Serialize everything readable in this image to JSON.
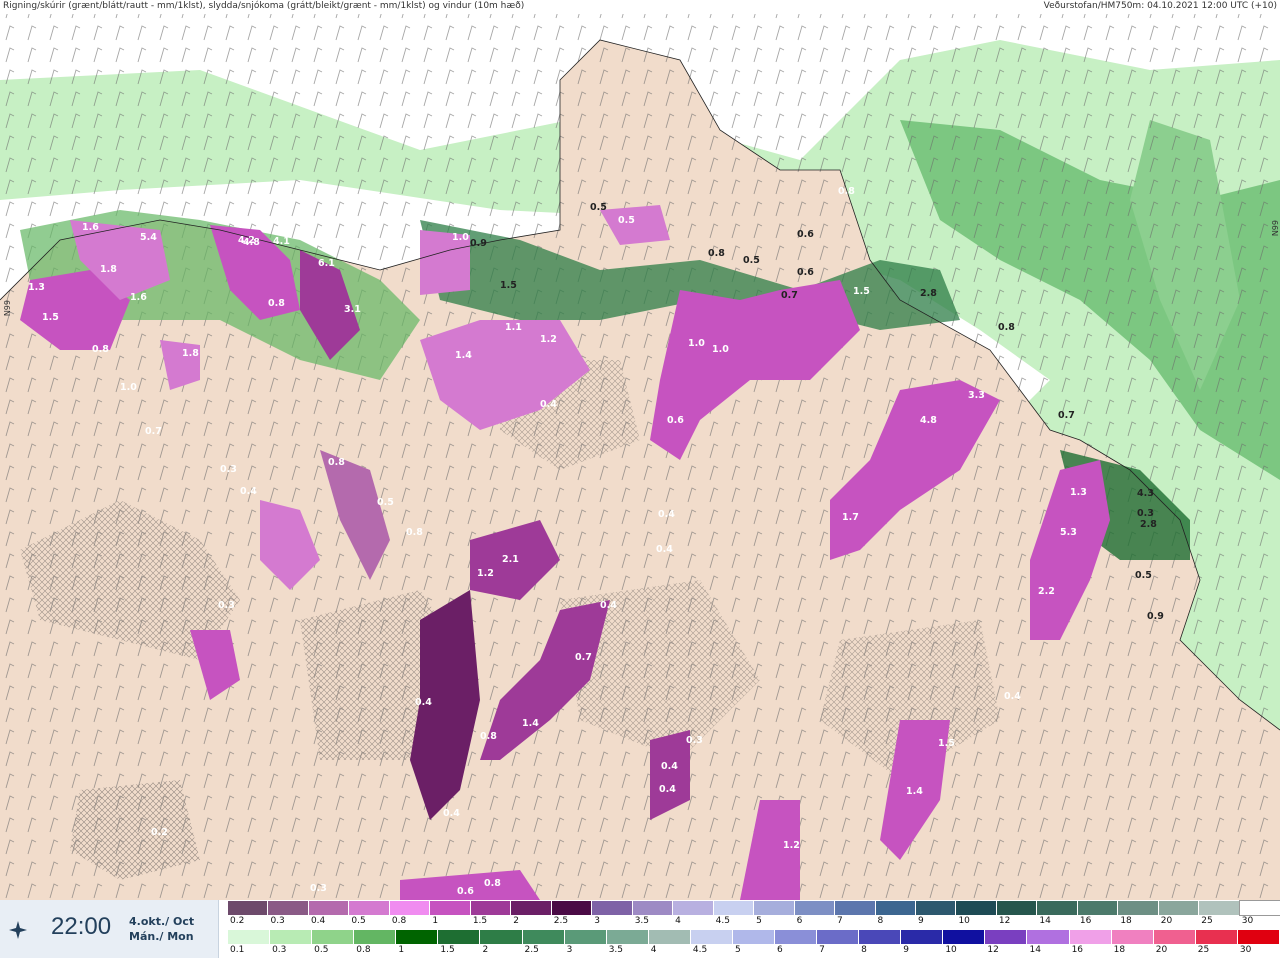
{
  "header": {
    "title": "Rigning/skúrir (grænt/blátt/rautt - mm/1klst), slydda/snjókoma (grátt/bleikt/grænt - mm/1klst) og vindur (10m hæð)",
    "run_info": "Veðurstofan/HM750m: 04.10.2021 12:00 UTC (+10)"
  },
  "time": {
    "value": "22:00",
    "date_line1": "4.okt./ Oct",
    "date_line2": "Mán./ Mon"
  },
  "legend_top": {
    "labels": [
      "0.2",
      "0.3",
      "0.4",
      "0.5",
      "0.8",
      "1",
      "1.5",
      "2",
      "2.5",
      "3",
      "3.5",
      "4",
      "4.5",
      "5",
      "6",
      "7",
      "8",
      "9",
      "10",
      "12",
      "14",
      "16",
      "18",
      "20",
      "25",
      "30"
    ],
    "colors": [
      "#6d4a6b",
      "#8a5a86",
      "#b46aad",
      "#d47ad0",
      "#f08cf0",
      "#c653c0",
      "#9e3a98",
      "#6b1f66",
      "#4a0a45",
      "#7e62a6",
      "#9d8ac4",
      "#b8b0e0",
      "#c8d0f0",
      "#a6aedc",
      "#7d8fc4",
      "#5c76ad",
      "#3c6690",
      "#2d586e",
      "#1e4b55",
      "#26564d",
      "#3a6a5c",
      "#4c7a6b",
      "#6d8f84",
      "#8aa69c",
      "#b0c2bc",
      "#ffffff"
    ]
  },
  "legend_bottom": {
    "labels": [
      "0.1",
      "0.3",
      "0.5",
      "0.8",
      "1",
      "1.5",
      "2",
      "2.5",
      "3",
      "3.5",
      "4",
      "4.5",
      "5",
      "6",
      "7",
      "8",
      "9",
      "10",
      "12",
      "14",
      "16",
      "18",
      "20",
      "25",
      "30"
    ],
    "colors": [
      "#d9f7d9",
      "#b8ebb4",
      "#8fd38a",
      "#63b663",
      "#006400",
      "#1e6e32",
      "#2e7d47",
      "#3f8a5c",
      "#5a9a78",
      "#7baa95",
      "#a2bcb3",
      "#c8d0f0",
      "#b0b8ea",
      "#8a8fd8",
      "#6b6cc8",
      "#4a48b8",
      "#2a2aa8",
      "#1010a0",
      "#7a3fc0",
      "#b070e0",
      "#f0a0e8",
      "#f080c0",
      "#f06090",
      "#e83050",
      "#e00010"
    ]
  },
  "map": {
    "labels": [
      {
        "t": "1.6"
      },
      {
        "t": "5.4"
      },
      {
        "t": "1.8"
      },
      {
        "t": "1.3"
      },
      {
        "t": "1.6"
      },
      {
        "t": "1.5"
      },
      {
        "t": "0.8"
      },
      {
        "t": "4.2"
      },
      {
        "t": "4.8"
      },
      {
        "t": "4.1"
      },
      {
        "t": "6.1"
      },
      {
        "t": "0.8"
      },
      {
        "t": "3.1"
      },
      {
        "t": "1.8"
      },
      {
        "t": "1.0"
      },
      {
        "t": "0.7"
      },
      {
        "t": "0.5"
      },
      {
        "t": "1.0"
      },
      {
        "t": "0.9"
      },
      {
        "t": "1.5"
      },
      {
        "t": "1.1"
      },
      {
        "t": "1.2"
      },
      {
        "t": "1.4"
      },
      {
        "t": "0.4"
      },
      {
        "t": "0.5"
      },
      {
        "t": "0.8"
      },
      {
        "t": "1.0"
      },
      {
        "t": "1.0"
      },
      {
        "t": "0.6"
      },
      {
        "t": "0.5"
      },
      {
        "t": "0.6"
      },
      {
        "t": "0.6"
      },
      {
        "t": "0.7"
      },
      {
        "t": "1.5"
      },
      {
        "t": "2.8"
      },
      {
        "t": "0.8"
      },
      {
        "t": "0.8"
      },
      {
        "t": "0.7"
      },
      {
        "t": "4.8"
      },
      {
        "t": "3.3"
      },
      {
        "t": "1.7"
      },
      {
        "t": "1.3"
      },
      {
        "t": "4.3"
      },
      {
        "t": "0.3"
      },
      {
        "t": "2.8"
      },
      {
        "t": "5.3"
      },
      {
        "t": "2.2"
      },
      {
        "t": "0.5"
      },
      {
        "t": "0.9"
      },
      {
        "t": "1.2"
      },
      {
        "t": "2.1"
      },
      {
        "t": "0.4"
      },
      {
        "t": "0.4"
      },
      {
        "t": "0.4"
      },
      {
        "t": "0.7"
      },
      {
        "t": "1.4"
      },
      {
        "t": "0.8"
      },
      {
        "t": "0.4"
      },
      {
        "t": "0.4"
      },
      {
        "t": "0.3"
      },
      {
        "t": "0.4"
      },
      {
        "t": "0.4"
      },
      {
        "t": "1.5"
      },
      {
        "t": "1.4"
      },
      {
        "t": "1.2"
      },
      {
        "t": "0.6"
      },
      {
        "t": "0.8"
      },
      {
        "t": "0.3"
      },
      {
        "t": "0.2"
      },
      {
        "t": "0.8"
      },
      {
        "t": "0.5"
      },
      {
        "t": "0.8"
      },
      {
        "t": "0.3"
      },
      {
        "t": "0.4"
      },
      {
        "t": "0.3"
      },
      {
        "t": "0.4"
      }
    ],
    "edge_label_left": "66N",
    "edge_label_right": "66N"
  }
}
